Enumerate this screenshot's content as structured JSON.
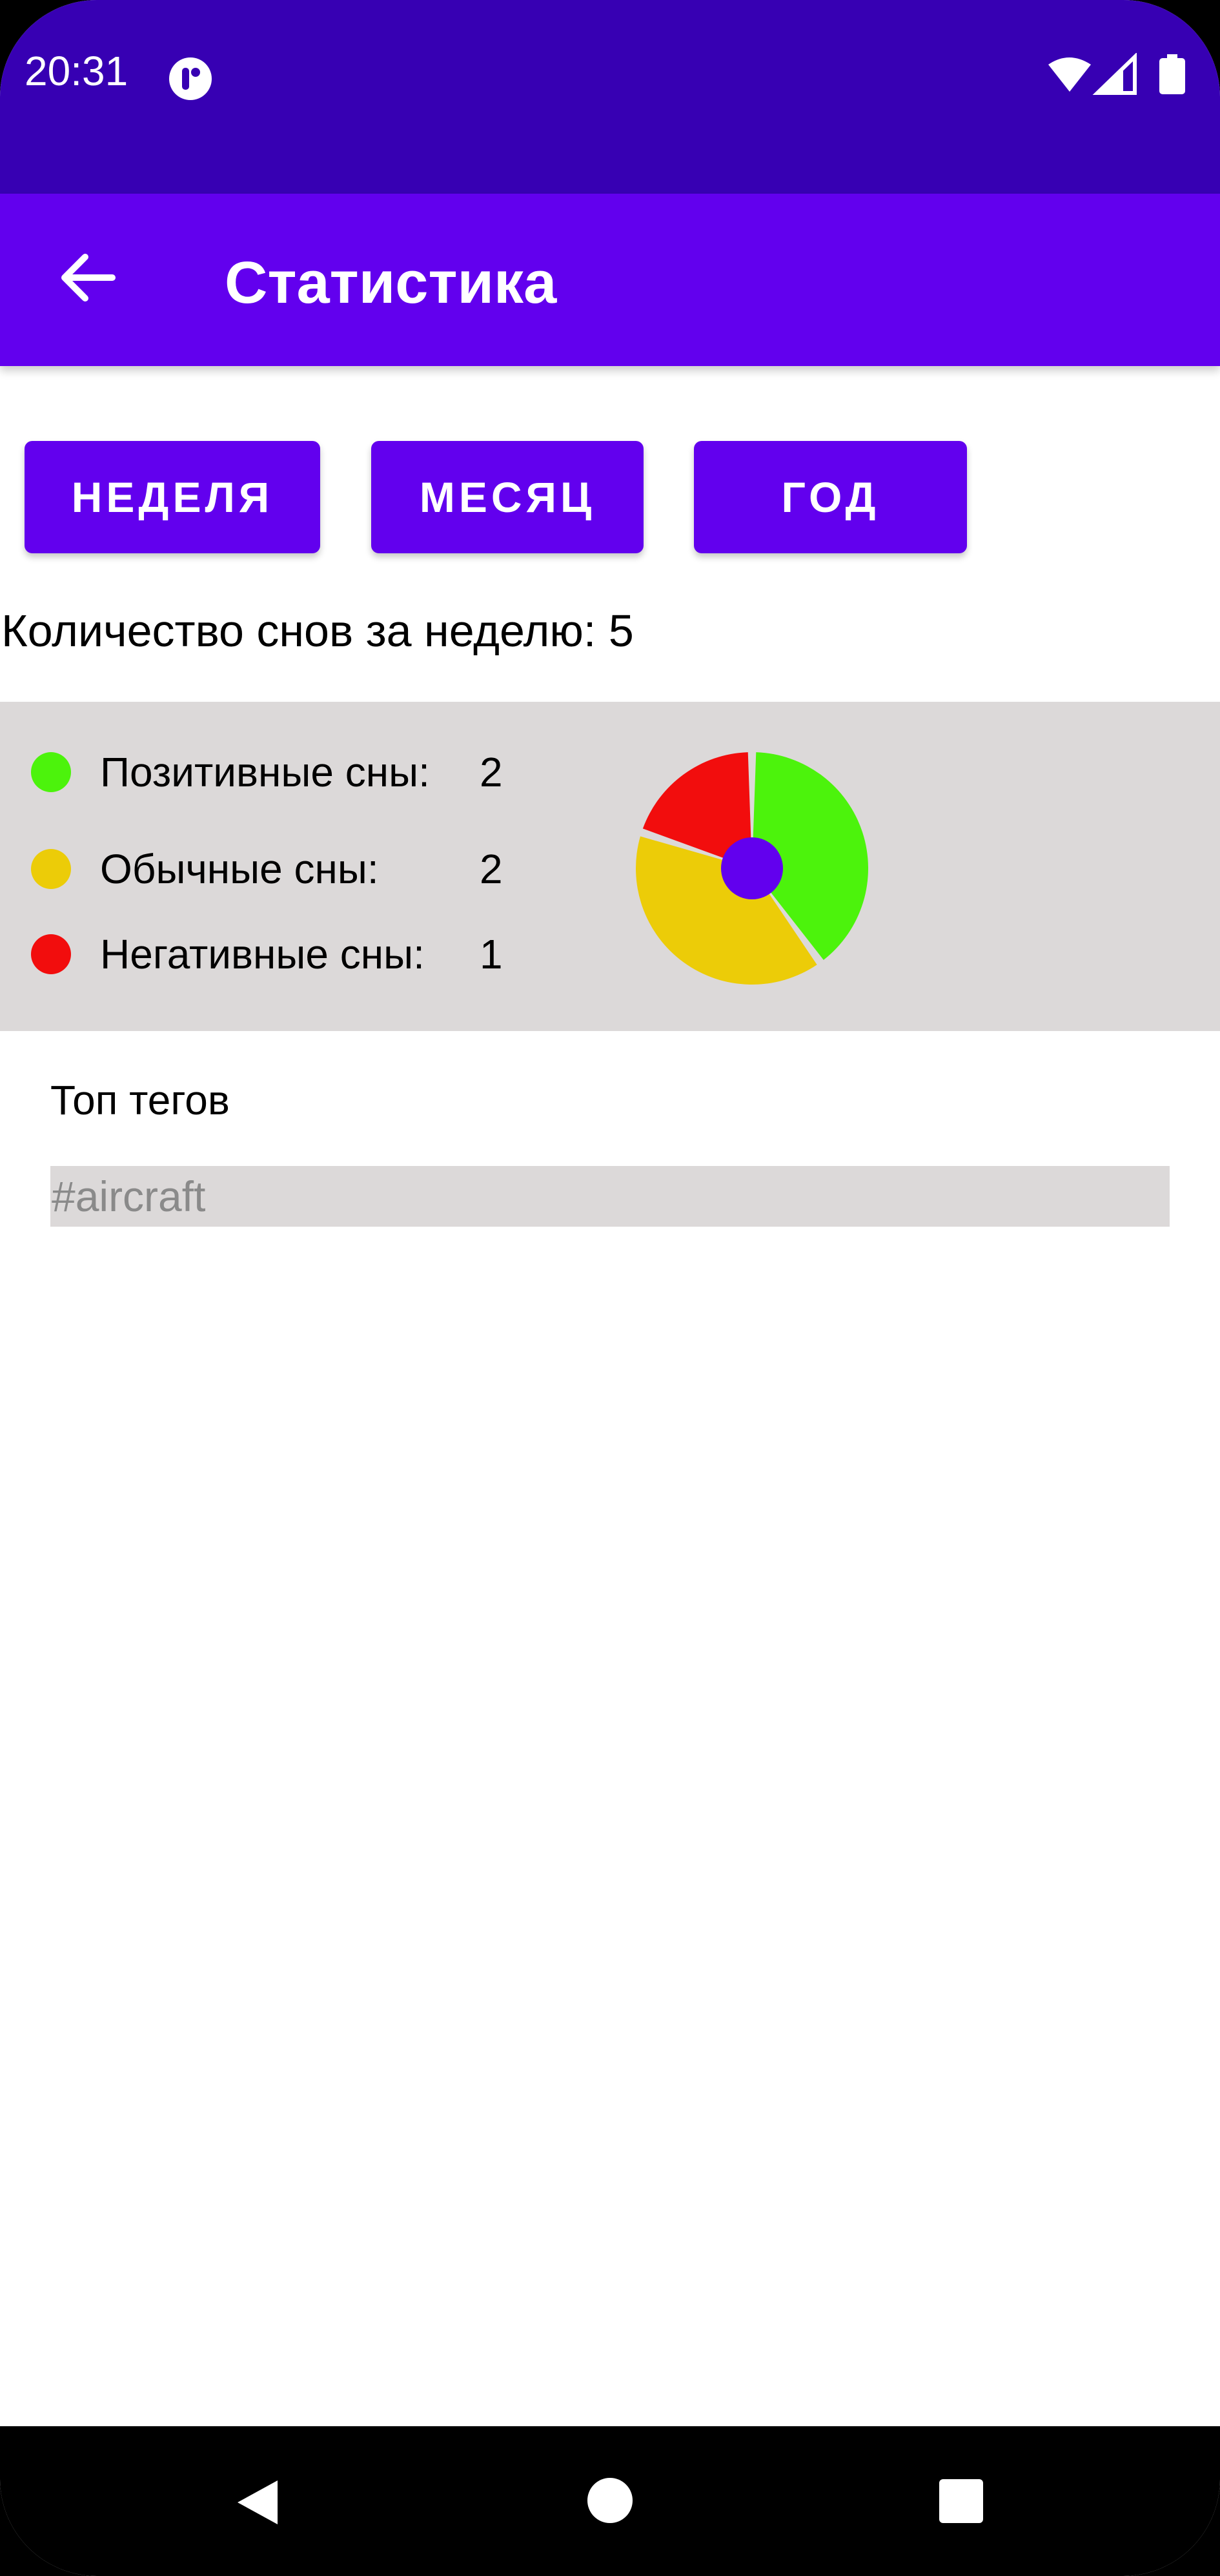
{
  "status_bar": {
    "time": "20:31",
    "icons": [
      "app-notification-icon",
      "wifi-icon",
      "cellular-signal-icon",
      "battery-icon"
    ]
  },
  "app_bar": {
    "title": "Статистика",
    "back_icon": "arrow-left-icon"
  },
  "period_tabs": [
    {
      "label": "НЕДЕЛЯ"
    },
    {
      "label": "МЕСЯЦ"
    },
    {
      "label": "ГОД"
    }
  ],
  "summary": {
    "label": "Количество снов за неделю:",
    "value": "5"
  },
  "legend": [
    {
      "label": "Позитивные сны:",
      "value": "2",
      "color": "#4cf30c"
    },
    {
      "label": "Обычные сны:",
      "value": "2",
      "color": "#eccc08"
    },
    {
      "label": "Негативные сны:",
      "value": "1",
      "color": "#f20d0d"
    }
  ],
  "chart_data": {
    "type": "pie",
    "categories": [
      "Позитивные сны",
      "Обычные сны",
      "Негативные сны"
    ],
    "values": [
      2,
      2,
      1
    ],
    "colors": [
      "#4cf30c",
      "#eccc08",
      "#f20d0d"
    ],
    "center_color": "#6200ee"
  },
  "tags": {
    "title": "Топ тегов",
    "items": [
      "#aircraft"
    ]
  },
  "colors": {
    "status_bar": "#3700b3",
    "primary": "#6200ee",
    "panel": "#dcd9d9"
  }
}
